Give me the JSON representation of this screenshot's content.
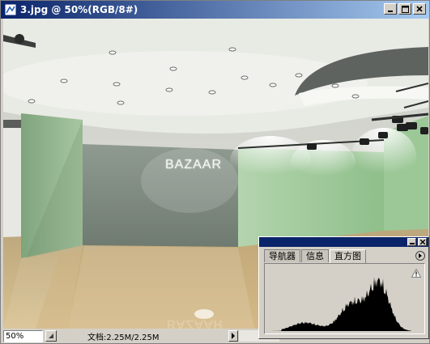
{
  "window": {
    "title": "3.jpg @ 50%(RGB/8#)",
    "icons": {
      "app": "photoshop-document-icon",
      "minimize": "minimize-icon",
      "maximize": "maximize-icon",
      "close": "close-icon"
    }
  },
  "canvas": {
    "sign_text": "BAZAAR",
    "sign_reflection": "BAZAAR"
  },
  "statusbar": {
    "zoom": "50%",
    "doc_info": "文档:2.25M/2.25M",
    "icons": {
      "menu": "status-menu-icon",
      "arrow": "triangle-right-icon"
    }
  },
  "panel": {
    "tabs": [
      {
        "label": "导航器",
        "active": false
      },
      {
        "label": "信息",
        "active": false
      },
      {
        "label": "直方图",
        "active": true
      }
    ],
    "icons": {
      "minimize": "minimize-icon",
      "close": "close-icon",
      "menu": "panel-menu-icon",
      "warning": "warning-icon"
    }
  },
  "colors": {
    "titlebar_start": "#0a246a",
    "titlebar_end": "#a6caf0",
    "chrome": "#d4d0c8",
    "accent_green": "#8fbf8a"
  }
}
